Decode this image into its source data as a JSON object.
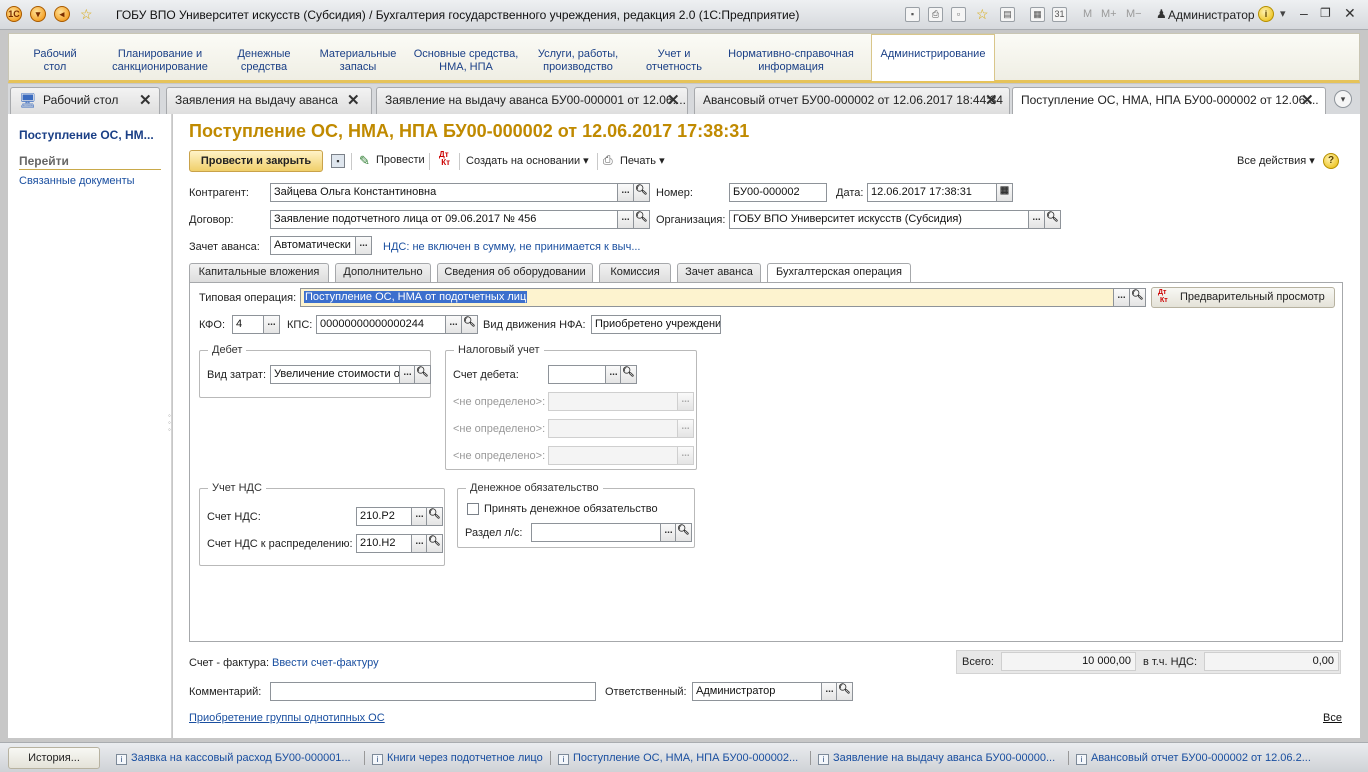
{
  "window": {
    "title": "ГОБУ ВПО Университет искусств (Субсидия) / Бухгалтерия государственного учреждения, редакция 2.0  (1С:Предприятие)",
    "toolbar_text": [
      "M",
      "M+",
      "M−"
    ],
    "user": "Администратор"
  },
  "sections": [
    {
      "line1": "Рабочий",
      "line2": "стол"
    },
    {
      "line1": "Планирование и",
      "line2": "санкционирование"
    },
    {
      "line1": "Денежные",
      "line2": "средства"
    },
    {
      "line1": "Материальные",
      "line2": "запасы"
    },
    {
      "line1": "Основные средства,",
      "line2": "НМА, НПА"
    },
    {
      "line1": "Услуги, работы,",
      "line2": "производство"
    },
    {
      "line1": "Учет и",
      "line2": "отчетность"
    },
    {
      "line1": "Нормативно-справочная",
      "line2": "информация"
    },
    {
      "line1": "Администрирование",
      "line2": ""
    }
  ],
  "window_tabs": [
    "Рабочий стол",
    "Заявления на выдачу аванса",
    "Заявление на выдачу аванса БУ00-000001 от 12.06....",
    "Авансовый отчет БУ00-000002 от 12.06.2017 18:44:34",
    "Поступление ОС, НМА, НПА БУ00-000002 от 12.06...."
  ],
  "left_panel": {
    "title": "Поступление ОС, НМ...",
    "goto": "Перейти",
    "links": [
      "Связанные документы"
    ]
  },
  "form": {
    "title": "Поступление ОС, НМА, НПА БУ00-000002 от 12.06.2017 17:38:31",
    "toolbar": {
      "post_close": "Провести и закрыть",
      "post": "Провести",
      "create_based": "Создать на основании",
      "print": "Печать",
      "all_actions": "Все действия"
    },
    "contractor_label": "Контрагент:",
    "contractor": "Зайцева Ольга Константиновна",
    "number_label": "Номер:",
    "number": "БУ00-000002",
    "date_label": "Дата:",
    "date": "12.06.2017 17:38:31",
    "contract_label": "Договор:",
    "contract": "Заявление подотчетного лица от 09.06.2017 № 456",
    "org_label": "Организация:",
    "org": "ГОБУ ВПО Университет искусств (Субсидия)",
    "advance_label": "Зачет аванса:",
    "advance": "Автоматически",
    "vat_link": "НДС: не включен в сумму, не принимается к выч...",
    "tabs": [
      "Капитальные вложения",
      "Дополнительно",
      "Сведения об оборудовании",
      "Комиссия",
      "Зачет аванса",
      "Бухгалтерская операция"
    ],
    "op_label": "Типовая операция:",
    "op": "Поступление ОС, НМА от подотчетных лиц",
    "preview": "Предварительный просмотр",
    "kfo_label": "КФО:",
    "kfo": "4",
    "kps_label": "КПС:",
    "kps": "00000000000000244",
    "nfa_label": "Вид движения НФА:",
    "nfa": "Приобретено учреждени",
    "debit_group": "Дебет",
    "cost_label": "Вид затрат:",
    "cost": "Увеличение стоимости о",
    "tax_group": "Налоговый учет",
    "debit_acc_label": "Счет дебета:",
    "undefined_label": "<не определено>:",
    "vat_group": "Учет НДС",
    "vat_acc_label": "Счет НДС:",
    "vat_acc": "210.Р2",
    "vat_dist_label": "Счет НДС к распределению:",
    "vat_dist": "210.Н2",
    "money_group": "Денежное обязательство",
    "accept_label": "Принять денежное обязательство",
    "section_label": "Раздел л/с:",
    "invoice_label": "Счет - фактура:",
    "invoice_link": "Ввести счет-фактуру",
    "total_label": "Всего:",
    "total": "10 000,00",
    "vat_total_label": "в т.ч. НДС:",
    "vat_total": "0,00",
    "comment_label": "Комментарий:",
    "comment": "",
    "responsible_label": "Ответственный:",
    "responsible": "Администратор",
    "group_link": "Приобретение группы однотипных ОС",
    "all_link": "Все"
  },
  "bottom_bar": {
    "history": "История...",
    "items": [
      "Заявка на кассовый расход БУ00-000001...",
      "Книги через подотчетное лицо",
      "Поступление ОС, НМА, НПА БУ00-000002...",
      "Заявление на выдачу аванса БУ00-00000...",
      "Авансовый отчет БУ00-000002 от 12.06.2..."
    ]
  }
}
